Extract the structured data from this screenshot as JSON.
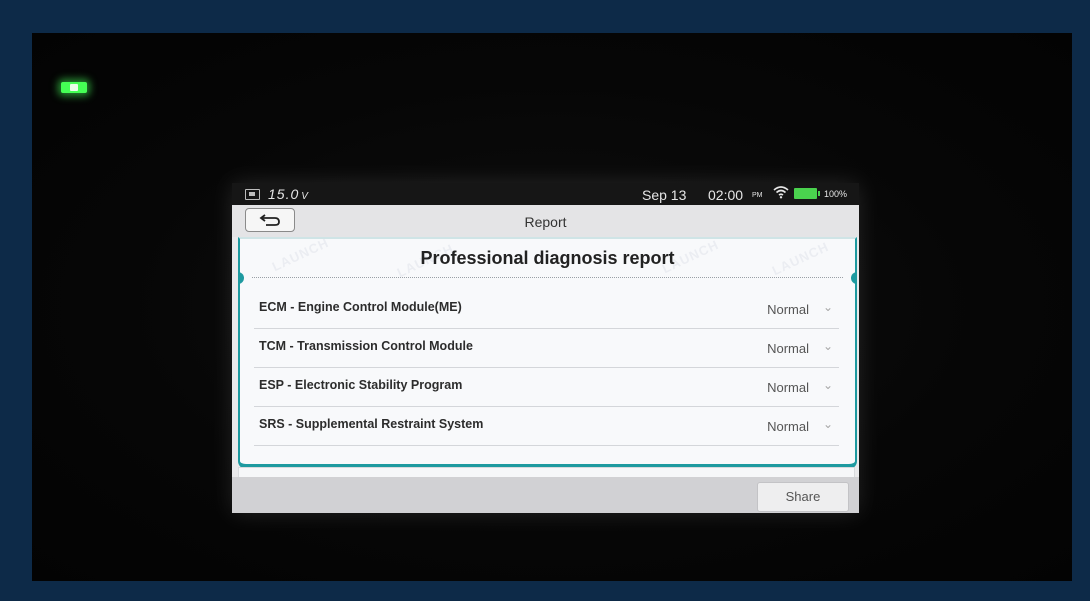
{
  "status_bar": {
    "voltage": "15.0",
    "voltage_unit": "V",
    "date": "Sep 13",
    "time": "02:00",
    "ampm": "PM",
    "battery_percent": "100%"
  },
  "title_bar": {
    "title": "Report"
  },
  "report": {
    "heading": "Professional diagnosis report",
    "watermark": "LAUNCH",
    "modules": [
      {
        "name": "ECM - Engine Control Module(ME)",
        "status": "Normal"
      },
      {
        "name": "TCM - Transmission Control Module",
        "status": "Normal"
      },
      {
        "name": "ESP - Electronic Stability Program",
        "status": "Normal"
      },
      {
        "name": "SRS - Supplemental Restraint System",
        "status": "Normal"
      }
    ]
  },
  "actions": {
    "share_label": "Share"
  },
  "colors": {
    "accent": "#1e9aa0",
    "battery": "#4ad24e",
    "led": "#45ff55"
  }
}
